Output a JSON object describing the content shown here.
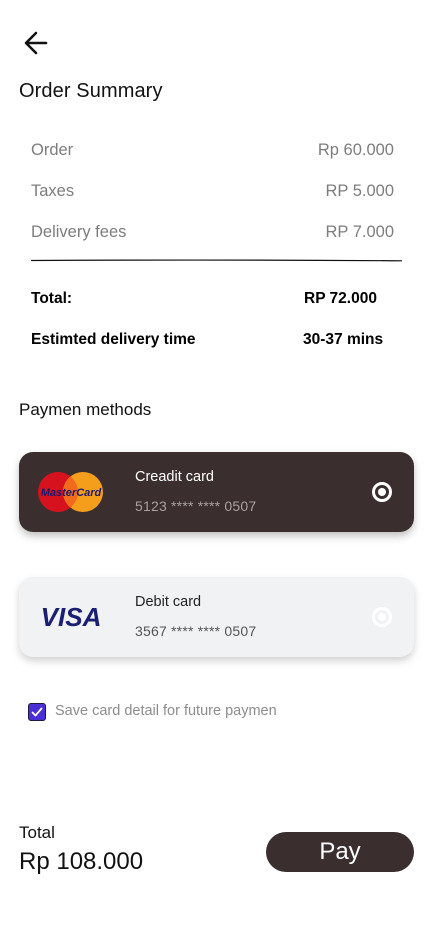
{
  "header": {
    "back_icon": "arrow-left-icon",
    "title": "Order Summary"
  },
  "summary": {
    "rows": [
      {
        "label": "Order",
        "value": "Rp 60.000"
      },
      {
        "label": "Taxes",
        "value": "RP 5.000"
      },
      {
        "label": "Delivery fees",
        "value": "RP 7.000"
      }
    ],
    "total_label": "Total:",
    "total_value": "RP 72.000",
    "delivery_label": "Estimted delivery time",
    "delivery_value": "30-37 mins"
  },
  "payment": {
    "title": "Paymen methods",
    "cards": [
      {
        "name": "Creadit card",
        "number": "5123 **** **** 0507",
        "brand": "mastercard-logo",
        "selected": true
      },
      {
        "name": "Debit card",
        "number": "3567 **** **** 0507",
        "brand": "visa-logo",
        "selected": false
      }
    ],
    "mastercard_text": "MasterCard",
    "visa_text": "VISA",
    "save_label": "Save card detail for future paymen",
    "save_checked": true
  },
  "footer": {
    "total_label": "Total",
    "total_value": "Rp 108.000",
    "pay_label": "Pay"
  },
  "colors": {
    "dark_card": "#3a2e2e",
    "light_card": "#f1f2f4",
    "checkbox": "#4a2fd4",
    "mastercard_red": "#d6121f",
    "mastercard_orange": "#f59e1b",
    "visa_blue": "#1a1f71"
  }
}
